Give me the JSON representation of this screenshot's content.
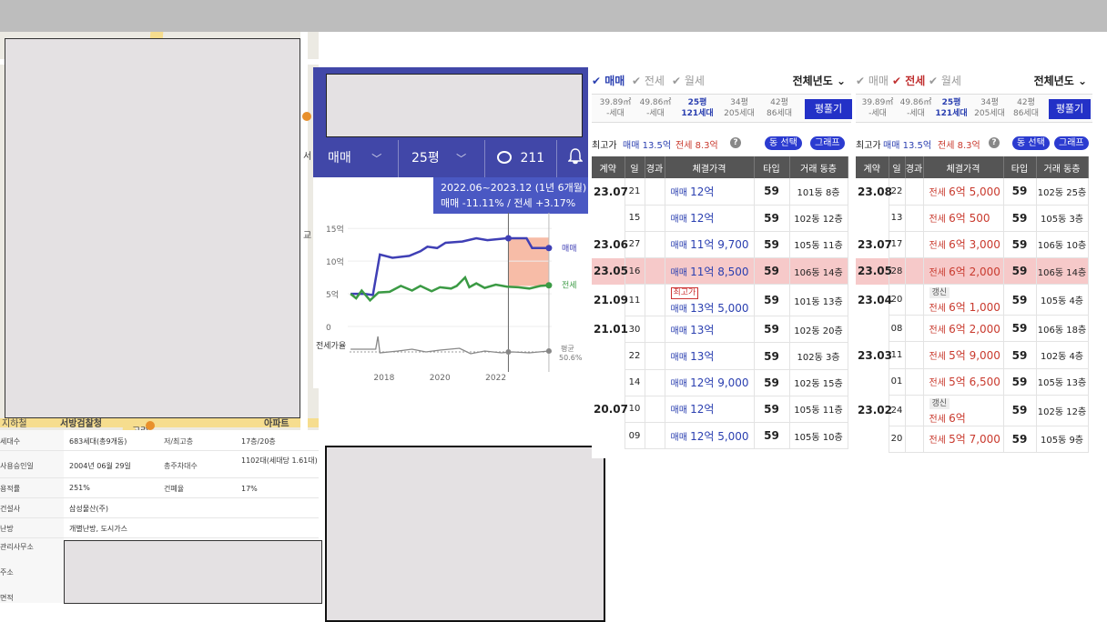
{
  "map": {
    "labels": [
      "서",
      "교",
      "지하철",
      "서방검찰청",
      "아파트",
      "고려"
    ]
  },
  "info": {
    "rows": [
      {
        "k": "세대수",
        "v": "683세대(총9개동)",
        "k2": "저/최고층",
        "v2": "17층/20층"
      },
      {
        "k": "사용승인일",
        "v": "2004년 06월 29일",
        "k2": "총주차대수",
        "v2": "1102대(세대당 1.61대)"
      },
      {
        "k": "용적률",
        "v": "251%",
        "k2": "건폐율",
        "v2": "17%"
      },
      {
        "k": "건설사",
        "v": "삼성물산(주)",
        "k2": "",
        "v2": ""
      },
      {
        "k": "난방",
        "v": "개별난방, 도시가스",
        "k2": "",
        "v2": ""
      }
    ],
    "extra_labels": [
      "관리사무소",
      "주소",
      "면적"
    ]
  },
  "chart_widget": {
    "deal_type": "매매",
    "size": "25평",
    "comment_count": "211",
    "tooltip_period": "2022.06~2023.12 (1년 6개월)",
    "tooltip_change": "매매 -11.11% / 전세 +3.17%",
    "series_labels": {
      "sale": "매매",
      "jeonse": "전세",
      "avg": "평균"
    },
    "avg_pct": "50.6%",
    "ratio_label": "전세가율"
  },
  "chart_data": {
    "type": "line",
    "x_ticks": [
      "2018",
      "2020",
      "2022"
    ],
    "y_ticks": [
      "15억",
      "10억",
      "5억",
      "0"
    ],
    "ylim": [
      0,
      16
    ],
    "xlim": [
      2016.7,
      2024.0
    ],
    "series": [
      {
        "name": "매매",
        "color": "#3f3fb5",
        "points": [
          [
            2016.8,
            5.0
          ],
          [
            2017.3,
            5.0
          ],
          [
            2017.6,
            4.8
          ],
          [
            2017.85,
            11.0
          ],
          [
            2018.3,
            10.5
          ],
          [
            2018.9,
            10.8
          ],
          [
            2019.3,
            11.5
          ],
          [
            2019.55,
            12.2
          ],
          [
            2019.9,
            12.0
          ],
          [
            2020.2,
            12.8
          ],
          [
            2020.8,
            13.0
          ],
          [
            2021.3,
            13.5
          ],
          [
            2021.7,
            13.2
          ],
          [
            2022.4,
            13.5
          ],
          [
            2023.1,
            13.5
          ],
          [
            2023.3,
            12.0
          ],
          [
            2023.9,
            12.0
          ]
        ]
      },
      {
        "name": "전세",
        "color": "#3b9a44",
        "points": [
          [
            2016.8,
            5.0
          ],
          [
            2017.0,
            4.3
          ],
          [
            2017.2,
            5.5
          ],
          [
            2017.5,
            4.0
          ],
          [
            2017.8,
            5.2
          ],
          [
            2018.2,
            5.3
          ],
          [
            2018.6,
            6.2
          ],
          [
            2019.0,
            5.5
          ],
          [
            2019.3,
            6.2
          ],
          [
            2019.7,
            5.4
          ],
          [
            2020.0,
            6.0
          ],
          [
            2020.4,
            5.8
          ],
          [
            2020.6,
            6.2
          ],
          [
            2020.9,
            7.5
          ],
          [
            2021.05,
            6.0
          ],
          [
            2021.3,
            6.6
          ],
          [
            2021.6,
            5.9
          ],
          [
            2022.0,
            6.4
          ],
          [
            2022.4,
            6.1
          ],
          [
            2022.8,
            6.0
          ],
          [
            2023.2,
            5.8
          ],
          [
            2023.6,
            6.2
          ],
          [
            2023.9,
            6.3
          ]
        ]
      }
    ]
  },
  "panel_left": {
    "filters": [
      "매매",
      "전세",
      "월세"
    ],
    "year": "전체년도",
    "sizes": [
      [
        "39.89㎡",
        "-세대"
      ],
      [
        "49.86㎡",
        "-세대"
      ],
      [
        "25평",
        "121세대"
      ],
      [
        "34평",
        "205세대"
      ],
      [
        "42평",
        "86세대"
      ]
    ],
    "btn": "평풀기",
    "max_label": "최고가",
    "max_sale": "매매 13.5억",
    "max_jeonse": "전세 8.3억",
    "help": "?",
    "dong_btn": "동 선택",
    "graph_btn": "그래프",
    "headers": [
      "계약",
      "일",
      "경과",
      "체결가격",
      "타입",
      "거래 동층"
    ],
    "rows": [
      {
        "ym": "23.07",
        "d": "21",
        "p1": "매매 ",
        "p2": "12억",
        "t": "59",
        "dn": "101동 8층"
      },
      {
        "ym": "",
        "d": "15",
        "p1": "매매 ",
        "p2": "12억",
        "t": "59",
        "dn": "102동 12층"
      },
      {
        "ym": "23.06",
        "d": "27",
        "p1": "매매 ",
        "p2": "11억 9,700",
        "t": "59",
        "dn": "105동 11층"
      },
      {
        "ym": "23.05",
        "d": "16",
        "p1": "매매 ",
        "p2": "11억 8,500",
        "t": "59",
        "dn": "106동 14층",
        "hl": true
      },
      {
        "ym": "21.09",
        "d": "11",
        "tag": "최고가",
        "p1": "매매 ",
        "p2": "13억 5,000",
        "t": "59",
        "dn": "101동 13층"
      },
      {
        "ym": "21.01",
        "d": "30",
        "p1": "매매 ",
        "p2": "13억",
        "t": "59",
        "dn": "102동 20층"
      },
      {
        "ym": "",
        "d": "22",
        "p1": "매매 ",
        "p2": "13억",
        "t": "59",
        "dn": "102동 3층"
      },
      {
        "ym": "",
        "d": "14",
        "p1": "매매 ",
        "p2": "12억 9,000",
        "t": "59",
        "dn": "102동 15층"
      },
      {
        "ym": "20.07",
        "d": "10",
        "p1": "매매 ",
        "p2": "12억",
        "t": "59",
        "dn": "105동 11층"
      },
      {
        "ym": "",
        "d": "09",
        "p1": "매매 ",
        "p2": "12억 5,000",
        "t": "59",
        "dn": "105동 10층"
      }
    ]
  },
  "panel_right": {
    "filters": [
      "매매",
      "전세",
      "월세"
    ],
    "year": "전체년도",
    "sizes": [
      [
        "39.89㎡",
        "-세대"
      ],
      [
        "49.86㎡",
        "-세대"
      ],
      [
        "25평",
        "121세대"
      ],
      [
        "34평",
        "205세대"
      ],
      [
        "42평",
        "86세대"
      ]
    ],
    "btn": "평풀기",
    "max_label": "최고가",
    "max_sale": "매매 13.5억",
    "max_jeonse": "전세 8.3억",
    "help": "?",
    "dong_btn": "동 선택",
    "graph_btn": "그래프",
    "headers": [
      "계약",
      "일",
      "경과",
      "체결가격",
      "타입",
      "거래 동층"
    ],
    "rows": [
      {
        "ym": "23.08",
        "d": "22",
        "p1": "전세 ",
        "p2": "6억 5,000",
        "t": "59",
        "dn": "102동 25층"
      },
      {
        "ym": "",
        "d": "13",
        "p1": "전세 ",
        "p2": "6억 500",
        "t": "59",
        "dn": "105동 3층"
      },
      {
        "ym": "23.07",
        "d": "17",
        "p1": "전세 ",
        "p2": "6억 3,000",
        "t": "59",
        "dn": "106동 10층"
      },
      {
        "ym": "23.05",
        "d": "28",
        "p1": "전세 ",
        "p2": "6억 2,000",
        "t": "59",
        "dn": "106동 14층",
        "hl": true
      },
      {
        "ym": "23.04",
        "d": "20",
        "tag2": "갱신",
        "p1": "전세 ",
        "p2": "6억 1,000",
        "t": "59",
        "dn": "105동 4층"
      },
      {
        "ym": "",
        "d": "08",
        "p1": "전세 ",
        "p2": "6억 2,000",
        "t": "59",
        "dn": "106동 18층"
      },
      {
        "ym": "23.03",
        "d": "11",
        "p1": "전세 ",
        "p2": "5억 9,000",
        "t": "59",
        "dn": "102동 4층"
      },
      {
        "ym": "",
        "d": "01",
        "p1": "전세 ",
        "p2": "5억 6,500",
        "t": "59",
        "dn": "105동 13층"
      },
      {
        "ym": "23.02",
        "d": "24",
        "tag2": "갱신",
        "p1": "전세 ",
        "p2": "6억",
        "t": "59",
        "dn": "102동 12층"
      },
      {
        "ym": "",
        "d": "20",
        "p1": "전세 ",
        "p2": "5억 7,000",
        "t": "59",
        "dn": "105동 9층"
      }
    ]
  }
}
